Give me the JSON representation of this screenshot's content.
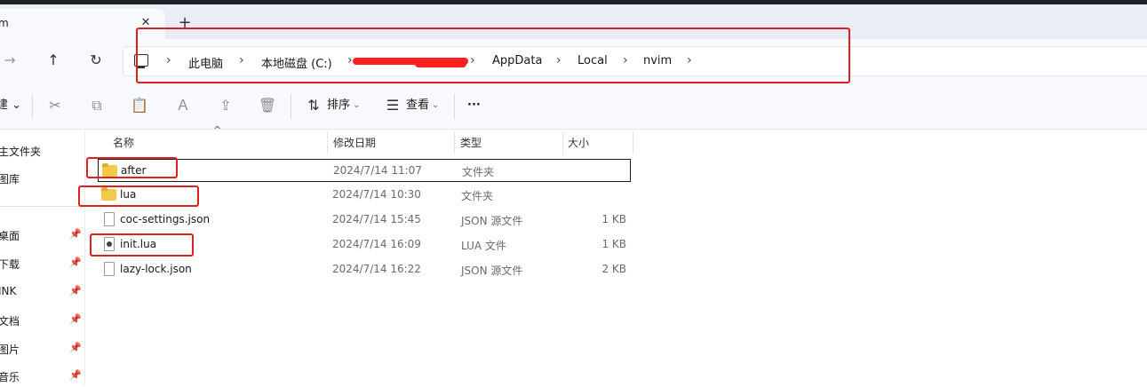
{
  "tab": {
    "title": "m",
    "close": "✕",
    "add": "+"
  },
  "nav": {
    "back": "←",
    "forward": "→",
    "up": "↑",
    "refresh": "↻"
  },
  "breadcrumb": {
    "sep": "›",
    "items": [
      "此电脑",
      "本地磁盘 (C:)",
      "AppData",
      "Local",
      "nvim"
    ]
  },
  "toolbar": {
    "new_label": "建 ⌄",
    "sort_label": "排序",
    "view_label": "查看",
    "more": "···",
    "caret": "⌄"
  },
  "navpane": {
    "items": [
      {
        "label": "主文件夹",
        "pinned": false
      },
      {
        "label": "图库",
        "pinned": false
      },
      {
        "label": "桌面",
        "pinned": true
      },
      {
        "label": "下载",
        "pinned": true
      },
      {
        "label": "INK",
        "pinned": true
      },
      {
        "label": "文档",
        "pinned": true
      },
      {
        "label": "图片",
        "pinned": true
      },
      {
        "label": "音乐",
        "pinned": true
      }
    ],
    "pin_glyph": "📌"
  },
  "columns": {
    "name": "名称",
    "date": "修改日期",
    "type": "类型",
    "size": "大小",
    "sort_glyph": "^"
  },
  "files": [
    {
      "name": "after",
      "date": "2024/7/14 11:07",
      "type": "文件夹",
      "size": "",
      "kind": "folder",
      "selected": true
    },
    {
      "name": "lua",
      "date": "2024/7/14 10:30",
      "type": "文件夹",
      "size": "",
      "kind": "folder",
      "selected": false
    },
    {
      "name": "coc-settings.json",
      "date": "2024/7/14 15:45",
      "type": "JSON 源文件",
      "size": "1 KB",
      "kind": "file",
      "selected": false
    },
    {
      "name": "init.lua",
      "date": "2024/7/14 16:09",
      "type": "LUA 文件",
      "size": "1 KB",
      "kind": "lua",
      "selected": false
    },
    {
      "name": "lazy-lock.json",
      "date": "2024/7/14 16:22",
      "type": "JSON 源文件",
      "size": "2 KB",
      "kind": "file",
      "selected": false
    }
  ],
  "colors": {
    "annotation": "#e02020",
    "folder": "#f4c84a",
    "chrome": "#f7f9fc"
  }
}
